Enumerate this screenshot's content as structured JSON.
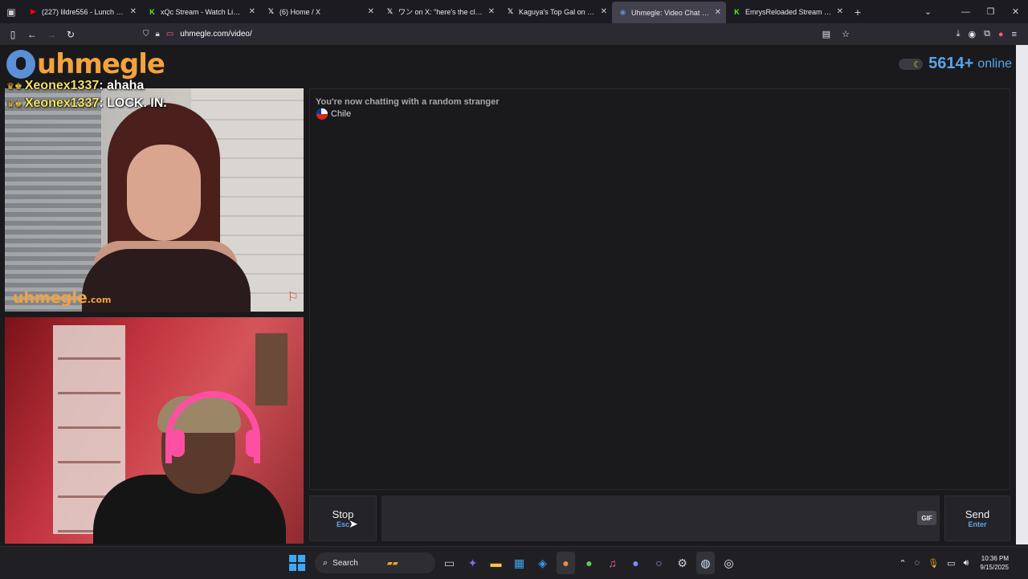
{
  "browser": {
    "tabs": [
      {
        "title": "(227) lildre556 - Lunch (Official",
        "favicon": "youtube-icon",
        "favicon_color": "#ff0000",
        "active": false
      },
      {
        "title": "xQc Stream - Watch Live on",
        "favicon": "kick-icon",
        "favicon_color": "#53fc18",
        "active": false
      },
      {
        "title": "(6) Home / X",
        "favicon": "x-icon",
        "favicon_color": "#ffffff",
        "active": false
      },
      {
        "title": "ワン on X: \"here's the clip t",
        "favicon": "x-icon",
        "favicon_color": "#ffffff",
        "active": false
      },
      {
        "title": "Kaguya's Top Gal on X: \"I w",
        "favicon": "x-icon",
        "favicon_color": "#ffffff",
        "active": false
      },
      {
        "title": "Uhmegle: Video Chat | Om",
        "favicon": "uhmegle-icon",
        "favicon_color": "#5b8fd6",
        "active": true
      },
      {
        "title": "EmrysReloaded Stream - Watch",
        "favicon": "kick-icon",
        "favicon_color": "#53fc18",
        "active": false
      }
    ],
    "url": "uhmegle.com/video/"
  },
  "site": {
    "logo_text": "uhmegle",
    "online_count": "5614+",
    "online_label": "online",
    "accent_color": "#5ba4e8",
    "brand_color": "#f4a23c"
  },
  "stranger_video": {
    "watermark": "uhmegle",
    "watermark_suffix": ".com",
    "overlay_chat": [
      {
        "user": "Xeonex1337",
        "message": "ahaha"
      },
      {
        "user": "Xeonex1337",
        "message": "LOCK. IN."
      }
    ]
  },
  "chat": {
    "status": "You're now chatting with a random stranger",
    "country": "Chile"
  },
  "controls": {
    "stop_label": "Stop",
    "stop_shortcut": "Esc",
    "gif_label": "GIF",
    "send_label": "Send",
    "send_shortcut": "Enter"
  },
  "taskbar": {
    "search_label": "Search",
    "time": "10:36 PM",
    "date": "9/15/2025"
  }
}
